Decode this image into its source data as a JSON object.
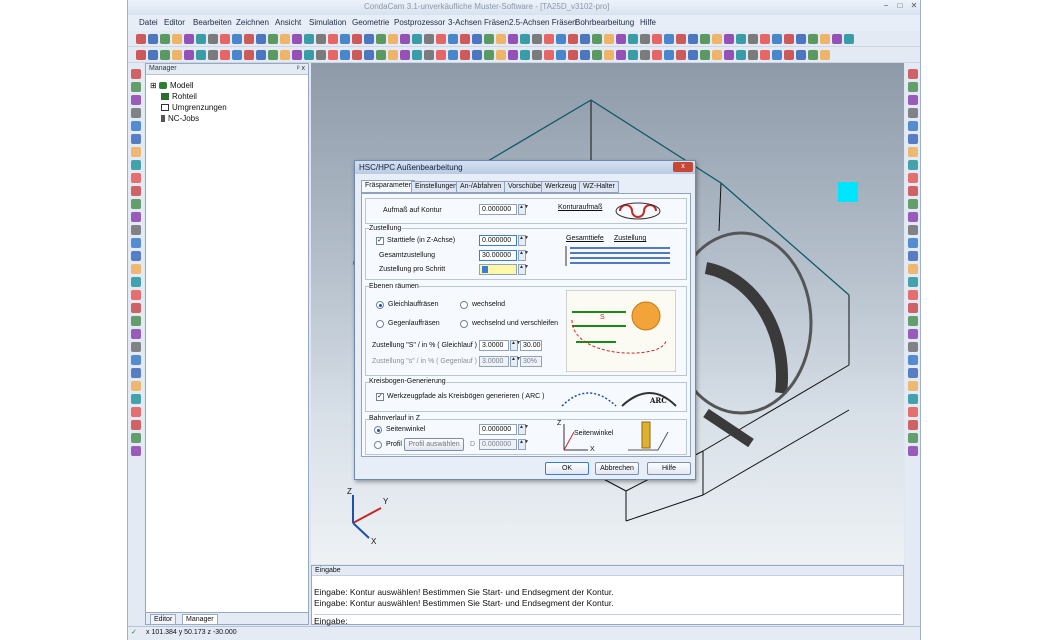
{
  "app": {
    "title": "CondaCam 3.1-unverkäufliche Muster-Software - [TA25D_v3102-pro]",
    "win_min": "−",
    "win_max": "□",
    "win_close": "✕"
  },
  "menu": [
    "Datei",
    "Editor",
    "Bearbeiten",
    "Zeichnen",
    "Ansicht",
    "Simulation",
    "Geometrie",
    "Postprozessor",
    "3-Achsen Fräsen",
    "2.5-Achsen Fräsen",
    "Bohrbearbeitung",
    "Hilfe"
  ],
  "manager": {
    "title": "Manager",
    "pin": "ᵖ x",
    "tree": [
      {
        "label": "Modell",
        "expand": "⊞",
        "color": "#2e7d32"
      },
      {
        "label": "Rohteil",
        "expand": "",
        "color": "#2e6b2e"
      },
      {
        "label": "Umgrenzungen",
        "expand": "",
        "color": "#ffffff"
      },
      {
        "label": "NC-Jobs",
        "expand": "",
        "color": "#333333"
      }
    ],
    "tabs": [
      "Editor",
      "Manager"
    ]
  },
  "input_panel": {
    "title": "Eingabe",
    "lines": [
      "Eingabe: Kontur auswählen! Bestimmen Sie Start- und Endsegment der Kontur.",
      "Eingabe: Kontur auswählen! Bestimmen Sie Start- und Endsegment der Kontur.",
      "Eingabe:"
    ]
  },
  "status": {
    "coords": "x 101.384 y 50.173 z -30.000"
  },
  "axes": {
    "x": "X",
    "y": "Y",
    "z": "Z"
  },
  "dialog": {
    "title": "HSC/HPC Außenbearbeitung",
    "close": "x",
    "tabs": [
      "Fräsparameter",
      "Einstellungen",
      "An-/Abfahren",
      "Vorschübe",
      "Werkzeug",
      "WZ-Halter"
    ],
    "aufmass": {
      "label": "Aufmaß auf Kontur",
      "value": "0.000000",
      "fig_label": "Konturaufmaß"
    },
    "zustellung": {
      "title": "Zustellung",
      "starttiefe_label": "Starttiefe (in Z-Achse)",
      "starttiefe_value": "0.000000",
      "gesamt_label": "Gesamtzustellung",
      "gesamt_value": "30.00000",
      "schritt_label": "Zustellung pro Schritt",
      "fig_label1": "Gesamttiefe",
      "fig_label2": "Zustellung"
    },
    "ebenen": {
      "title": "Ebenen räumen",
      "opt1": "Gleichlauffräsen",
      "opt2": "wechselnd",
      "opt3": "Gegenlauffräsen",
      "opt4": "wechselnd und verschleifen",
      "z1_label": "Zustellung \"S\" / in %  ( Gleichlauf )",
      "z1_value": "3.0000",
      "z1_pct": "30.00",
      "z2_label": "Zustellung \"s\" / in %  ( Gegenlauf )",
      "z2_value": "3.0000",
      "z2_pct": "30%",
      "fig_s": "S"
    },
    "kreis": {
      "title": "Kreisbogen-Generierung",
      "label": "Werkzeugpfade als Kreisbögen generieren ( ARC )",
      "fig": "ARC"
    },
    "bahn": {
      "title": "Bahnverlauf in Z",
      "opt1": "Seitenwinkel",
      "opt2": "Profil",
      "btn": "Profil auswählen",
      "val1": "0.000000",
      "val2": "0.000000",
      "d_label": "D",
      "fig": "Seitenwinkel",
      "fig_z": "Z",
      "fig_x": "X"
    },
    "buttons": {
      "ok": "OK",
      "cancel": "Abbrechen",
      "help": "Hilfe"
    }
  },
  "colors": {
    "accent": "#1b4fb0",
    "cyan": "#00e5ff",
    "green": "#1a8a1a"
  }
}
